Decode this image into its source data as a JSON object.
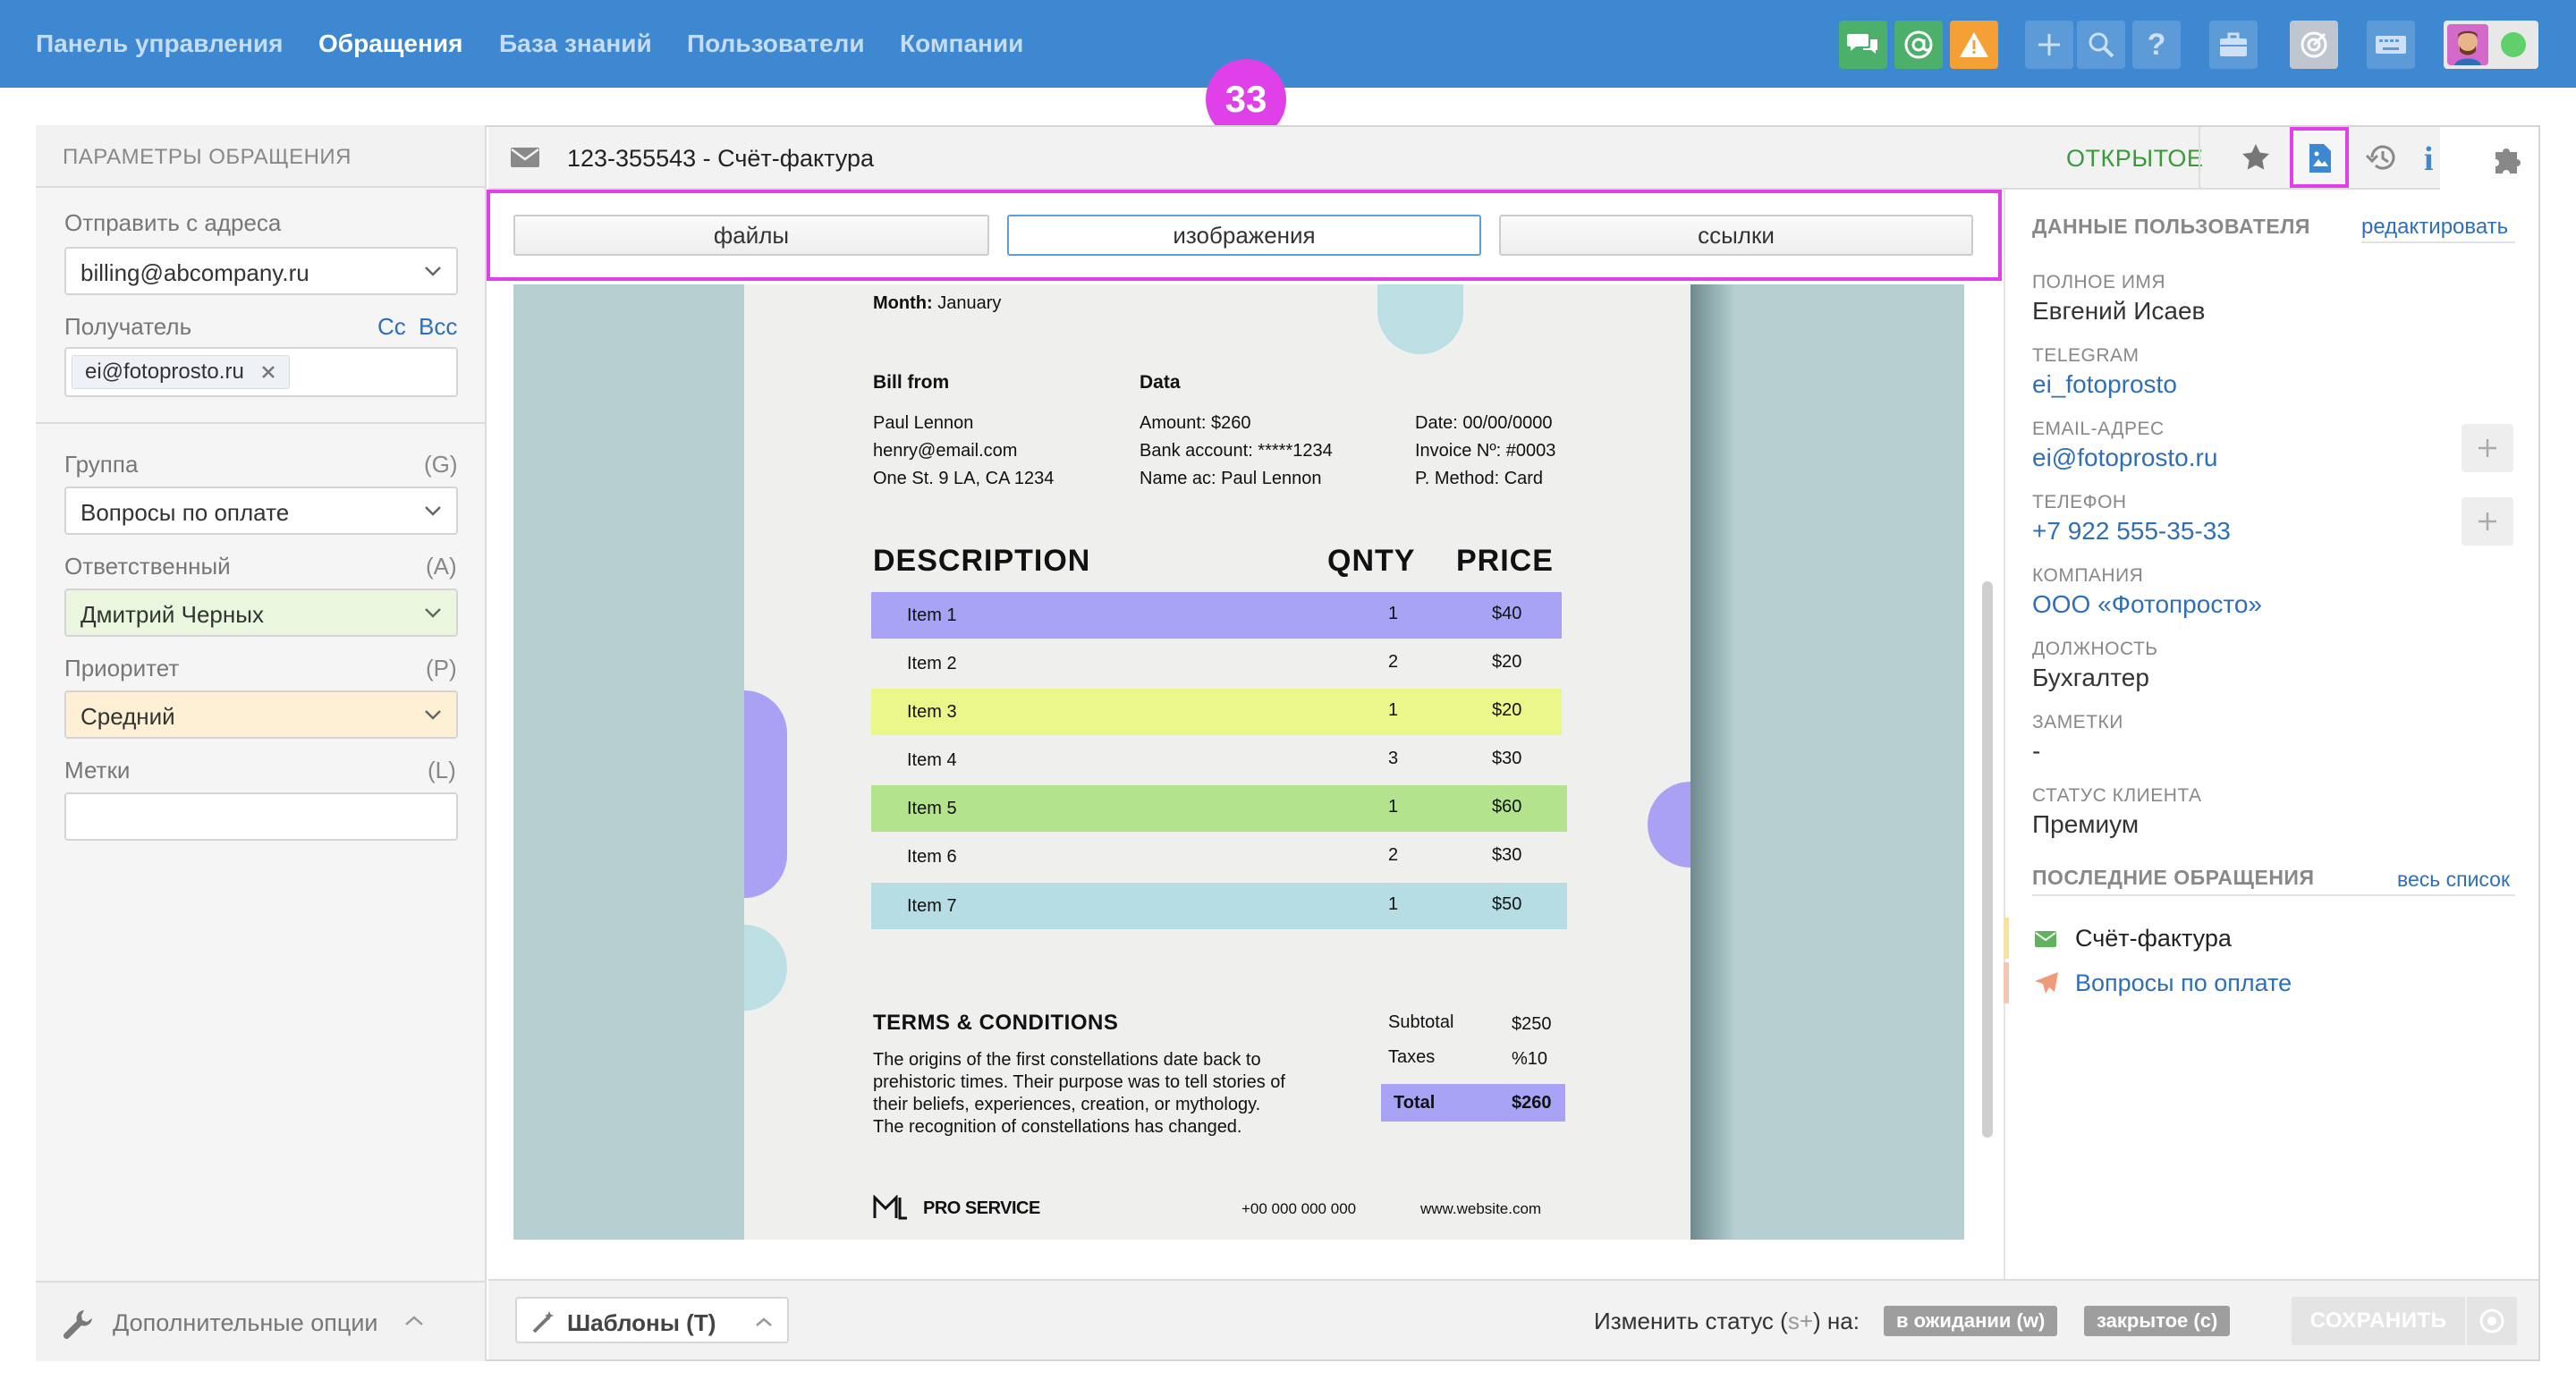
{
  "nav": {
    "items": [
      "Панель управления",
      "Обращения",
      "База знаний",
      "Пользователи",
      "Компании"
    ],
    "active": "Обращения"
  },
  "toolbar_icons": [
    "chat-icon",
    "at-icon",
    "warning-icon",
    "plus-icon",
    "search-icon",
    "help-icon",
    "briefcase-icon",
    "target-icon",
    "keyboard-icon",
    "avatar",
    "online-status"
  ],
  "colors": {
    "nav_bg": "#3d88d1",
    "accent_magenta": "#e040e8",
    "status_open": "#3a9a3a",
    "link": "#2f6fb8"
  },
  "annotation": {
    "number": "33"
  },
  "left": {
    "header": "ПАРАМЕТРЫ ОБРАЩЕНИЯ",
    "send_from_label": "Отправить с адреса",
    "send_from_value": "billing@abcompany.ru",
    "recipient_label": "Получатель",
    "cc": "Cc",
    "bcc": "Bcc",
    "recipient_tag": "ei@fotoprosto.ru",
    "group_label": "Группа",
    "group_key": "(G)",
    "group_value": "Вопросы по оплате",
    "assignee_label": "Ответственный",
    "assignee_key": "(A)",
    "assignee_value": "Дмитрий Черных",
    "priority_label": "Приоритет",
    "priority_key": "(P)",
    "priority_value": "Средний",
    "tags_label": "Метки",
    "tags_key": "(L)",
    "extra_options": "Дополнительные опции"
  },
  "ticket": {
    "title": "123-355543 - Счёт-фактура",
    "status": "ОТКРЫТОЕ"
  },
  "tabs": [
    "файлы",
    "изображения",
    "ссылки"
  ],
  "active_tab": "изображения",
  "invoice": {
    "month_label": "Month:",
    "month": "January",
    "bill_from": "Bill from",
    "data": "Data",
    "from_lines": [
      "Paul Lennon",
      "henry@email.com",
      "One St. 9 LA, CA 1234"
    ],
    "data_lines": [
      "Amount: $260",
      "Bank account: *****1234",
      "Name ac: Paul Lennon"
    ],
    "meta_lines": [
      "Date: 00/00/0000",
      "Invoice Nº: #0003",
      "P. Method: Card"
    ],
    "col_description": "DESCRIPTION",
    "col_qnty": "QNTY",
    "col_price": "PRICE",
    "items": [
      {
        "name": "Item 1",
        "qty": "1",
        "price": "$40",
        "color": "#a8a3f5"
      },
      {
        "name": "Item 2",
        "qty": "2",
        "price": "$20",
        "color": ""
      },
      {
        "name": "Item 3",
        "qty": "1",
        "price": "$20",
        "color": "#ecf78a"
      },
      {
        "name": "Item 4",
        "qty": "3",
        "price": "$30",
        "color": ""
      },
      {
        "name": "Item 5",
        "qty": "1",
        "price": "$60",
        "color": "#b4e38e"
      },
      {
        "name": "Item 6",
        "qty": "2",
        "price": "$30",
        "color": ""
      },
      {
        "name": "Item 7",
        "qty": "1",
        "price": "$50",
        "color": "#b7dde4"
      }
    ],
    "terms_title": "TERMS & CONDITIONS",
    "terms_lines": [
      "The origins of the first constellations date back to",
      "prehistoric times. Their purpose was to tell stories of",
      "their beliefs, experiences, creation, or mythology.",
      "The recognition of constellations has changed."
    ],
    "subtotal_label": "Subtotal",
    "subtotal": "$250",
    "taxes_label": "Taxes",
    "taxes": "%10",
    "total_label": "Total",
    "total": "$260",
    "brand": "PRO SERVICE",
    "phone": "+00 000 000 000",
    "website": "www.website.com"
  },
  "user": {
    "section_title": "ДАННЫЕ ПОЛЬЗОВАТЕЛЯ",
    "edit_link": "редактировать",
    "full_name_label": "ПОЛНОЕ ИМЯ",
    "full_name": "Евгений Исаев",
    "telegram_label": "TELEGRAM",
    "telegram": "ei_fotoprosto",
    "email_label": "EMAIL-АДРЕС",
    "email": "ei@fotoprosto.ru",
    "phone_label": "ТЕЛЕФОН",
    "phone": "+7 922 555-35-33",
    "company_label": "КОМПАНИЯ",
    "company": "ООО «Фотопросто»",
    "position_label": "ДОЛЖНОСТЬ",
    "position": "Бухгалтер",
    "notes_label": "ЗАМЕТКИ",
    "notes": "-",
    "client_status_label": "СТАТУС КЛИЕНТА",
    "client_status": "Премиум",
    "recent_title": "ПОСЛЕДНИЕ ОБРАЩЕНИЯ",
    "all_link": "весь список",
    "recent": [
      "Счёт-фактура",
      "Вопросы по оплате"
    ]
  },
  "bottom": {
    "templates": "Шаблоны (T)",
    "change_status_prefix": "Изменить статус (",
    "change_status_key": "s+",
    "change_status_suffix": ") на:",
    "pending": "в ожидании (w)",
    "closed": "закрытое (c)",
    "save": "СОХРАНИТЬ"
  }
}
